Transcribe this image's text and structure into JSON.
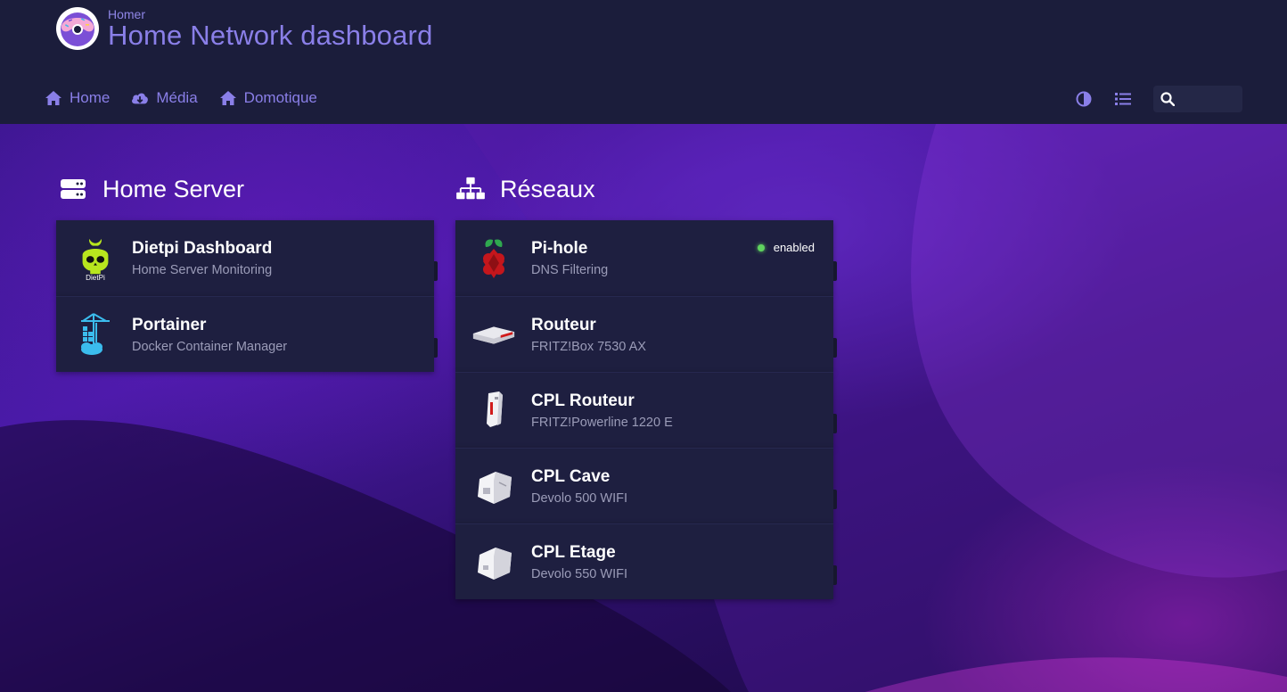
{
  "colors": {
    "accent": "#8a7fe8",
    "header_bg": "#1b1d3b",
    "card_bg": "#1e1f40",
    "status_ok": "#5fd35f"
  },
  "header": {
    "subtitle": "Homer",
    "title": "Home Network dashboard",
    "logo_icon": "donut-icon"
  },
  "nav": {
    "items": [
      {
        "label": "Home",
        "icon": "home-icon"
      },
      {
        "label": "Média",
        "icon": "cloud-download-icon"
      },
      {
        "label": "Domotique",
        "icon": "home-icon"
      }
    ]
  },
  "toolbar": {
    "theme_icon": "contrast-icon",
    "layout_icon": "list-icon",
    "search_icon": "search-icon",
    "search_value": ""
  },
  "groups": [
    {
      "title": "Home Server",
      "icon": "server-icon",
      "items": [
        {
          "name": "Dietpi Dashboard",
          "subtitle": "Home Server Monitoring",
          "logo": "dietpi-logo"
        },
        {
          "name": "Portainer",
          "subtitle": "Docker Container Manager",
          "logo": "portainer-logo"
        }
      ]
    },
    {
      "title": "Réseaux",
      "icon": "network-icon",
      "items": [
        {
          "name": "Pi-hole",
          "subtitle": "DNS Filtering",
          "logo": "pihole-logo",
          "status": "enabled"
        },
        {
          "name": "Routeur",
          "subtitle": "FRITZ!Box 7530 AX",
          "logo": "router-image"
        },
        {
          "name": "CPL Routeur",
          "subtitle": "FRITZ!Powerline 1220 E",
          "logo": "powerline-image"
        },
        {
          "name": "CPL Cave",
          "subtitle": "Devolo 500 WIFI",
          "logo": "devolo-image"
        },
        {
          "name": "CPL Etage",
          "subtitle": "Devolo 550 WIFI",
          "logo": "devolo-image"
        }
      ]
    }
  ]
}
